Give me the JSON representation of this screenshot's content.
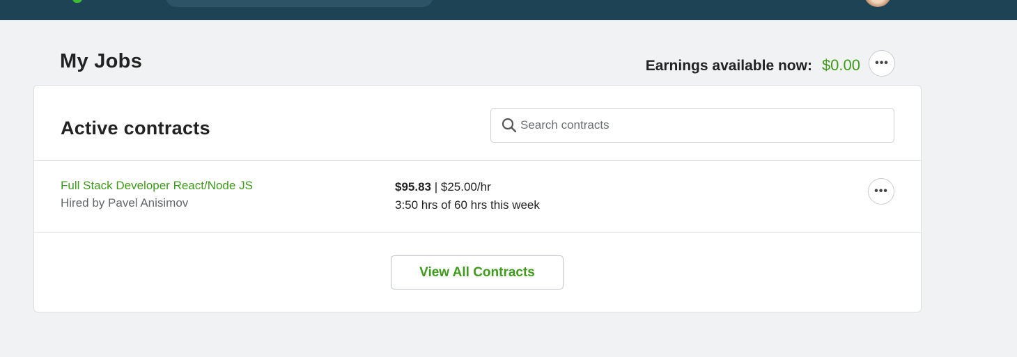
{
  "header": {
    "logo_icon": "upwork-logo-icon",
    "avatar_icon": "user-avatar"
  },
  "page": {
    "title": "My Jobs",
    "earnings_label": "Earnings available now:",
    "earnings_amount": "$0.00",
    "more_icon": "ellipsis-icon"
  },
  "active_contracts": {
    "title": "Active contracts",
    "search_placeholder": "Search contracts",
    "search_value": "",
    "contracts": [
      {
        "title": "Full Stack Developer React/Node JS",
        "hired_by": "Hired by Pavel Anisimov",
        "earned": "$95.83",
        "separator": "|",
        "rate": "$25.00/hr",
        "hours": "3:50 hrs of 60 hrs this week"
      }
    ],
    "view_all_label": "View All Contracts"
  },
  "colors": {
    "header_bg": "#1d4354",
    "accent_green": "#3f9b1b",
    "page_bg": "#f1f2f4"
  }
}
